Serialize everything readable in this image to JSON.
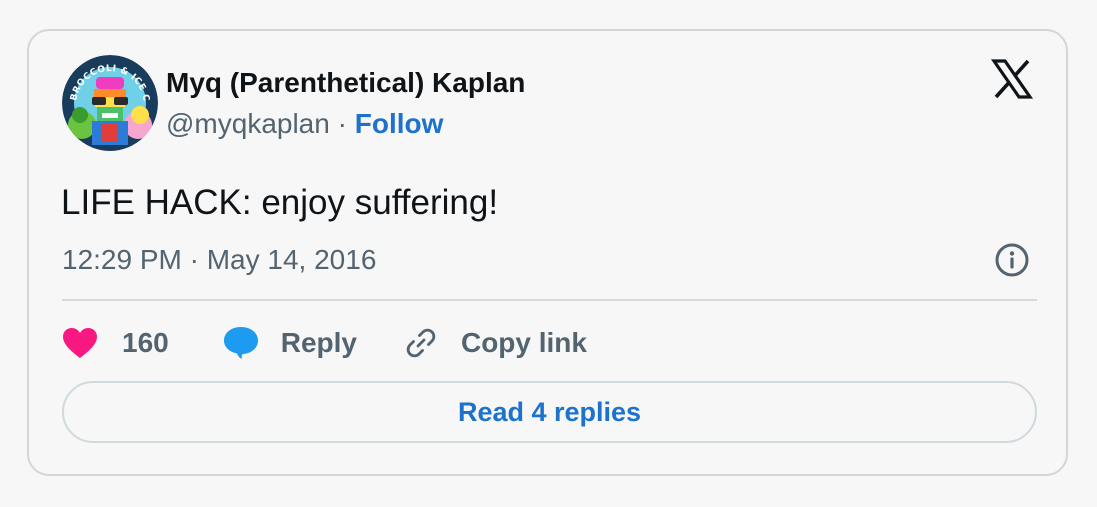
{
  "tweet": {
    "author": {
      "display_name": "Myq (Parenthetical) Kaplan",
      "handle": "@myqkaplan",
      "separator": " · ",
      "follow_label": "Follow",
      "avatar_text": "BROCCOLI & ICE CREAM"
    },
    "text": "LIFE HACK: enjoy suffering!",
    "timestamp": "12:29 PM · May 14, 2016",
    "actions": {
      "like_count": "160",
      "reply_label": "Reply",
      "copy_link_label": "Copy link"
    },
    "read_replies_label": "Read 4 replies"
  },
  "colors": {
    "link": "#1d72cc",
    "text_primary": "#0f1419",
    "text_secondary": "#536471",
    "like": "#f91880",
    "reply": "#1d9bf0",
    "border": "#d2d6da"
  },
  "icons": {
    "brand": "x-logo-icon",
    "info": "info-icon",
    "like": "heart-icon",
    "reply": "speech-bubble-icon",
    "copy": "link-icon"
  }
}
